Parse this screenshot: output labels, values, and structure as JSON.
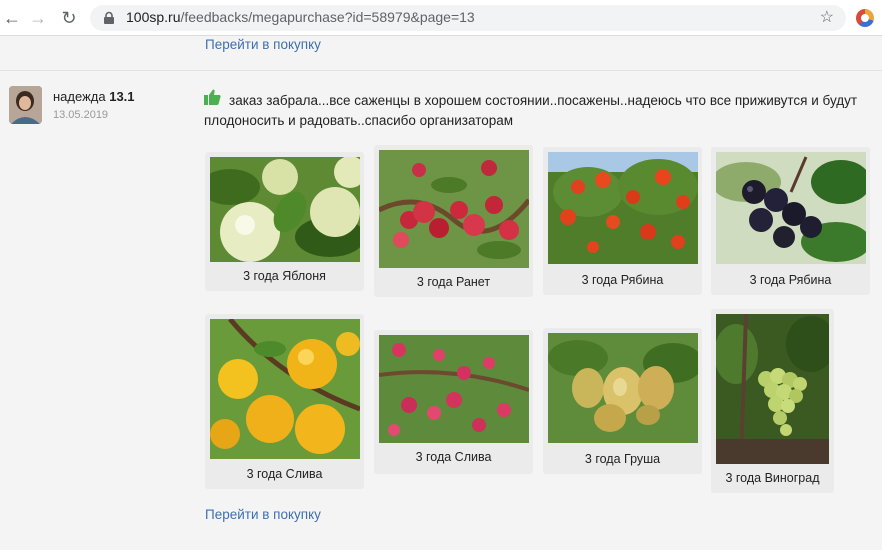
{
  "browser": {
    "url_host": "100sp.ru",
    "url_path": "/feedbacks/megapurchase?id=58979&page=13"
  },
  "links": {
    "top": "Перейти в покупку",
    "bottom": "Перейти в покупку"
  },
  "review": {
    "author": "надежда",
    "rating": "13.1",
    "date": "13.05.2019",
    "text": "заказ забрала...все саженцы в хорошем состоянии..посажены..надеюсь что все приживутся и будут плодоносить и радовать..спасибо организаторам"
  },
  "photos": [
    {
      "caption": "3 года Яблоня"
    },
    {
      "caption": "3 года Ранет"
    },
    {
      "caption": "3 года Рябина"
    },
    {
      "caption": "3 года Рябина"
    },
    {
      "caption": "3 года Слива"
    },
    {
      "caption": "3 года Слива"
    },
    {
      "caption": "3 года Груша"
    },
    {
      "caption": "3 года Виноград"
    }
  ],
  "colors": {
    "link": "#3f6fb0",
    "like": "#4caf50",
    "card_bg": "#ebebeb"
  },
  "icons": [
    "back-arrow-icon",
    "forward-arrow-icon",
    "reload-icon",
    "lock-icon",
    "star-icon",
    "extension-icon",
    "thumbs-up-icon"
  ]
}
